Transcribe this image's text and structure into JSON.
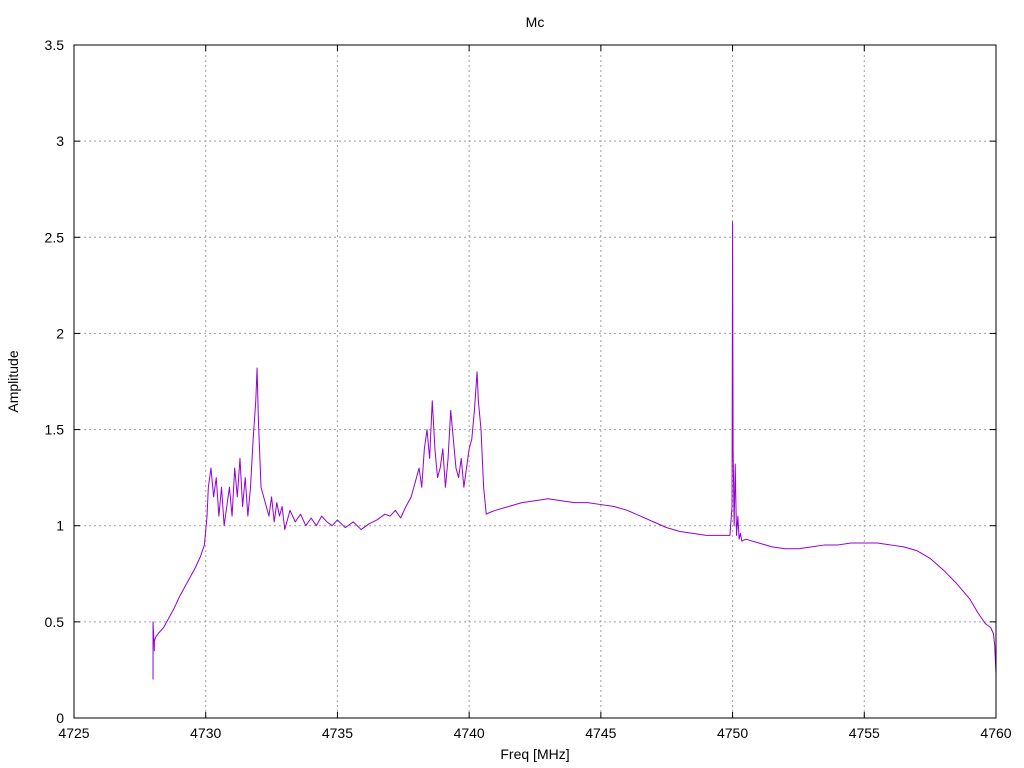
{
  "chart_data": {
    "type": "line",
    "title": "Mc",
    "xlabel": "Freq [MHz]",
    "ylabel": "Amplitude",
    "xlim": [
      4725,
      4760
    ],
    "ylim": [
      0,
      3.5
    ],
    "xticks": [
      4725,
      4730,
      4735,
      4740,
      4745,
      4750,
      4755,
      4760
    ],
    "xtick_labels": [
      "4725",
      "4730",
      "4735",
      "4740",
      "4745",
      "4750",
      "4755",
      "4760"
    ],
    "yticks": [
      0,
      0.5,
      1,
      1.5,
      2,
      2.5,
      3,
      3.5
    ],
    "ytick_labels": [
      "0",
      "0.5",
      "1",
      "1.5",
      "2",
      "2.5",
      "3",
      "3.5"
    ],
    "grid": true,
    "legend": "none",
    "series": [
      {
        "color": "#9400d3",
        "x": [
          4728.0,
          4728.0,
          4728.05,
          4728.05,
          4728.1,
          4728.2,
          4728.4,
          4728.6,
          4728.8,
          4729.0,
          4729.2,
          4729.4,
          4729.6,
          4729.8,
          4729.95,
          4730.05,
          4730.1,
          4730.2,
          4730.3,
          4730.4,
          4730.5,
          4730.6,
          4730.7,
          4730.8,
          4730.9,
          4731.0,
          4731.1,
          4731.2,
          4731.3,
          4731.4,
          4731.5,
          4731.6,
          4731.7,
          4731.8,
          4731.9,
          4731.95,
          4732.0,
          4732.1,
          4732.2,
          4732.3,
          4732.4,
          4732.5,
          4732.6,
          4732.7,
          4732.8,
          4732.9,
          4733.0,
          4733.2,
          4733.4,
          4733.6,
          4733.8,
          4734.0,
          4734.2,
          4734.4,
          4734.6,
          4734.8,
          4735.0,
          4735.3,
          4735.6,
          4735.9,
          4736.2,
          4736.5,
          4736.8,
          4737.0,
          4737.2,
          4737.4,
          4737.6,
          4737.8,
          4738.0,
          4738.1,
          4738.2,
          4738.3,
          4738.4,
          4738.5,
          4738.6,
          4738.7,
          4738.8,
          4738.9,
          4739.0,
          4739.1,
          4739.2,
          4739.3,
          4739.4,
          4739.5,
          4739.6,
          4739.7,
          4739.8,
          4739.9,
          4740.0,
          4740.1,
          4740.2,
          4740.3,
          4740.35,
          4740.45,
          4740.55,
          4740.65,
          4740.8,
          4741.0,
          4741.5,
          4742.0,
          4742.5,
          4743.0,
          4743.5,
          4744.0,
          4744.5,
          4745.0,
          4745.5,
          4746.0,
          4746.5,
          4747.0,
          4747.5,
          4748.0,
          4748.5,
          4749.0,
          4749.5,
          4749.9,
          4749.98,
          4750.0,
          4750.02,
          4750.06,
          4750.1,
          4750.15,
          4750.2,
          4750.25,
          4750.3,
          4750.35,
          4750.5,
          4751.0,
          4751.5,
          4752.0,
          4752.5,
          4753.0,
          4753.5,
          4754.0,
          4754.5,
          4755.0,
          4755.5,
          4756.0,
          4756.5,
          4757.0,
          4757.5,
          4758.0,
          4758.5,
          4759.0,
          4759.3,
          4759.6,
          4759.8,
          4759.9,
          4759.95,
          4760.0
        ],
        "y": [
          0.2,
          0.5,
          0.35,
          0.4,
          0.42,
          0.44,
          0.47,
          0.52,
          0.57,
          0.63,
          0.68,
          0.73,
          0.78,
          0.84,
          0.9,
          1.05,
          1.2,
          1.3,
          1.15,
          1.25,
          1.05,
          1.2,
          1.0,
          1.1,
          1.2,
          1.05,
          1.3,
          1.15,
          1.35,
          1.1,
          1.25,
          1.05,
          1.2,
          1.45,
          1.65,
          1.82,
          1.55,
          1.2,
          1.15,
          1.1,
          1.05,
          1.15,
          1.02,
          1.12,
          1.05,
          1.1,
          0.98,
          1.08,
          1.02,
          1.06,
          1.0,
          1.04,
          1.0,
          1.05,
          1.02,
          1.0,
          1.03,
          0.99,
          1.02,
          0.98,
          1.01,
          1.03,
          1.06,
          1.05,
          1.08,
          1.04,
          1.1,
          1.15,
          1.25,
          1.3,
          1.2,
          1.4,
          1.5,
          1.35,
          1.65,
          1.4,
          1.25,
          1.3,
          1.4,
          1.2,
          1.35,
          1.6,
          1.45,
          1.3,
          1.25,
          1.35,
          1.2,
          1.3,
          1.4,
          1.45,
          1.6,
          1.8,
          1.65,
          1.5,
          1.2,
          1.06,
          1.07,
          1.08,
          1.1,
          1.12,
          1.13,
          1.14,
          1.13,
          1.12,
          1.12,
          1.11,
          1.1,
          1.08,
          1.05,
          1.02,
          0.99,
          0.97,
          0.96,
          0.95,
          0.95,
          0.95,
          1.1,
          2.58,
          1.4,
          1.0,
          1.32,
          0.95,
          1.05,
          0.93,
          0.96,
          0.92,
          0.93,
          0.91,
          0.89,
          0.88,
          0.88,
          0.89,
          0.9,
          0.9,
          0.91,
          0.91,
          0.91,
          0.9,
          0.89,
          0.87,
          0.83,
          0.77,
          0.7,
          0.62,
          0.55,
          0.49,
          0.47,
          0.44,
          0.38,
          0.23
        ]
      }
    ]
  }
}
